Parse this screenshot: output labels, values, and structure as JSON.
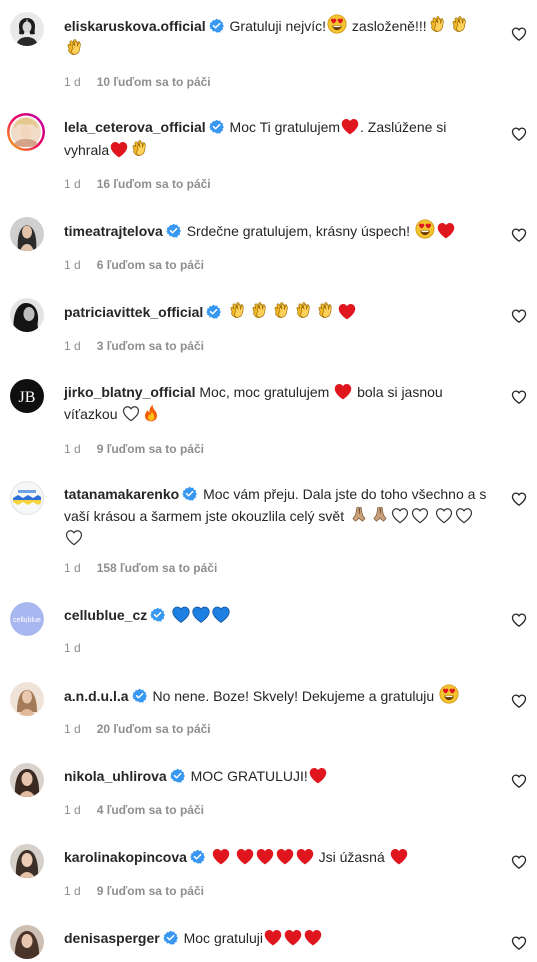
{
  "comments": [
    {
      "username": "eliskaruskova.official",
      "verified": true,
      "text": "Gratuluji nejvíc!",
      "text2": " zasloženě!!!",
      "age": "1 d",
      "likes": "10 ľuďom sa to páči",
      "avatar": "bw-portrait"
    },
    {
      "username": "lela_ceterova_official",
      "verified": true,
      "text": "Moc Ti gratulujem",
      "text2": ". Zaslúžene si vyhrala",
      "age": "1 d",
      "likes": "16 ľuďom sa to páči",
      "avatar": "story-ring-portrait"
    },
    {
      "username": "timeatrajtelova",
      "verified": true,
      "text": "Srdečne gratulujem, krásny úspech!",
      "age": "1 d",
      "likes": "6 ľuďom sa to páči",
      "avatar": "portrait"
    },
    {
      "username": "patriciavittek_official",
      "verified": true,
      "text": "",
      "age": "1 d",
      "likes": "3 ľuďom sa to páči",
      "avatar": "bw-portrait"
    },
    {
      "username": "jirko_blatny_official",
      "verified": false,
      "text": "Moc, moc gratulujem",
      "text2": " bola si jasnou víťazkou",
      "age": "1 d",
      "likes": "9 ľuďom sa to páči",
      "avatar": "JB"
    },
    {
      "username": "tatanamakarenko",
      "verified": true,
      "text": "Moc vám přeju. Dala jste do toho všechno a s vaší krásou a šarmem jste okouzlila celý svět",
      "age": "1 d",
      "likes": "158 ľuďom sa to páči",
      "avatar": "flag-graphic"
    },
    {
      "username": "cellublue_cz",
      "verified": true,
      "text": "",
      "age": "1 d",
      "likes": "",
      "avatar": "cellublue"
    },
    {
      "username": "a.n.d.u.l.a",
      "verified": true,
      "text": "No nene. Boze! Skvely! Dekujeme a gratuluju",
      "age": "1 d",
      "likes": "20 ľuďom sa to páči",
      "avatar": "portrait"
    },
    {
      "username": "nikola_uhlirova",
      "verified": true,
      "text": "MOC GRATULUJI!",
      "age": "1 d",
      "likes": "4 ľuďom sa to páči",
      "avatar": "portrait"
    },
    {
      "username": "karolinakopincova",
      "verified": true,
      "text": "Jsi úžasná",
      "age": "1 d",
      "likes": "9 ľuďom sa to páči",
      "avatar": "portrait"
    },
    {
      "username": "denisasperger",
      "verified": true,
      "text": "Moc gratuluji",
      "age": "",
      "likes": "",
      "avatar": "portrait"
    }
  ],
  "avatar_text": {
    "jb": "JB",
    "cellublue": "cellublue"
  },
  "colors": {
    "verified": "#3897f0",
    "meta": "#8e8e8e",
    "red_heart": "#e0161f",
    "blue_heart": "#1d7fe0",
    "clap": "#f2b829"
  },
  "icons": {
    "like": "heart-outline-icon",
    "verified": "verified-badge-icon"
  }
}
